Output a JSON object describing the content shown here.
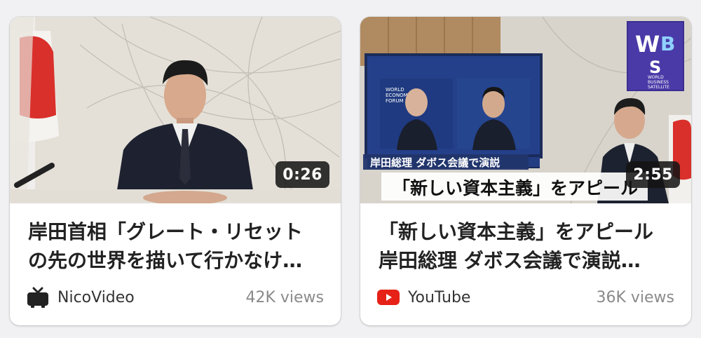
{
  "cards": [
    {
      "duration": "0:26",
      "title_lines": [
        "岸田首相「グレート・リセット",
        "の先の世界を描いて行かなけ…"
      ],
      "source": "NicoVideo",
      "source_icon": "nicovideo-tv-icon",
      "views": "42K views"
    },
    {
      "duration": "2:55",
      "title_lines": [
        "「新しい資本主義」をアピール",
        "岸田総理 ダボス会議で演説…"
      ],
      "source": "YouTube",
      "source_icon": "youtube-play-icon",
      "views": "36K views",
      "thumbnail_text": {
        "caption_small": "岸田総理 ダボス会議で演説",
        "caption_large": "「新しい資本主義」をアピール",
        "logo_sub": [
          "WORLD",
          "BUSINESS",
          "SATELLITE"
        ],
        "forum_text": [
          "WORLD",
          "ECONOMIC",
          "FORUM"
        ]
      }
    }
  ],
  "colors": {
    "youtube_red": "#e62117",
    "nico_dark": "#222222"
  }
}
